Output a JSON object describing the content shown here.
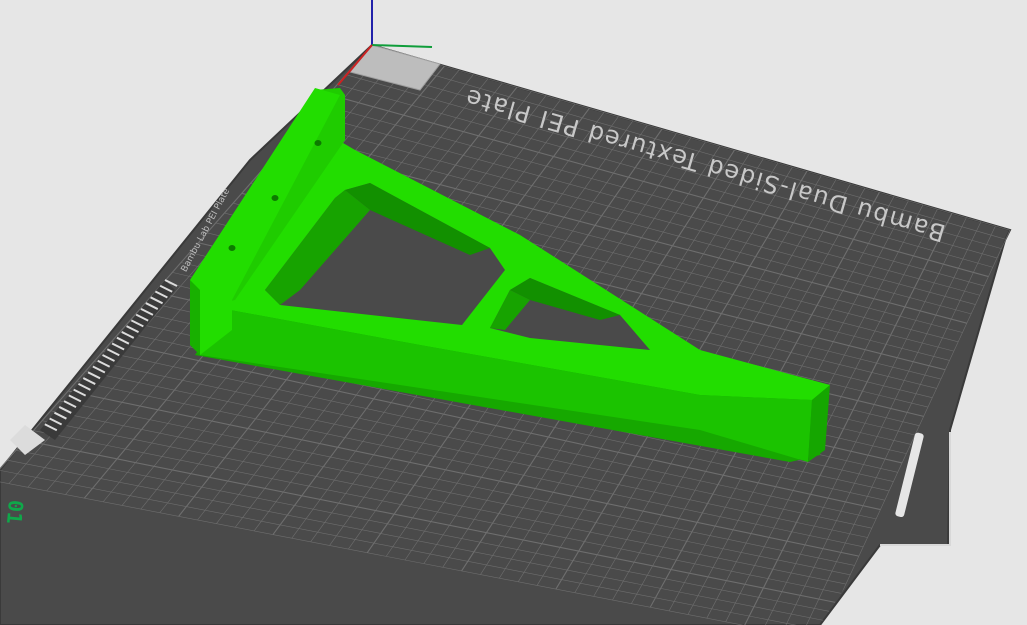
{
  "viewport": {
    "background": "#e6e6e6"
  },
  "plate": {
    "name": "Bambu Dual-Sided Textured PEI Plate",
    "edge_label": "Bambu Lab PEI Plate",
    "number": "01",
    "surface_color": "#4a4a4a",
    "grid_color": "#6e6e6e",
    "label_color": "#c8c8c8",
    "number_color": "#0fa84a"
  },
  "model": {
    "name": "triangular-shelf-bracket",
    "color": "#22dd00",
    "shade_color": "#16a800"
  },
  "axes": {
    "x_color": "#0f9d3a",
    "y_color": "#cc2222",
    "z_color": "#2222aa"
  }
}
